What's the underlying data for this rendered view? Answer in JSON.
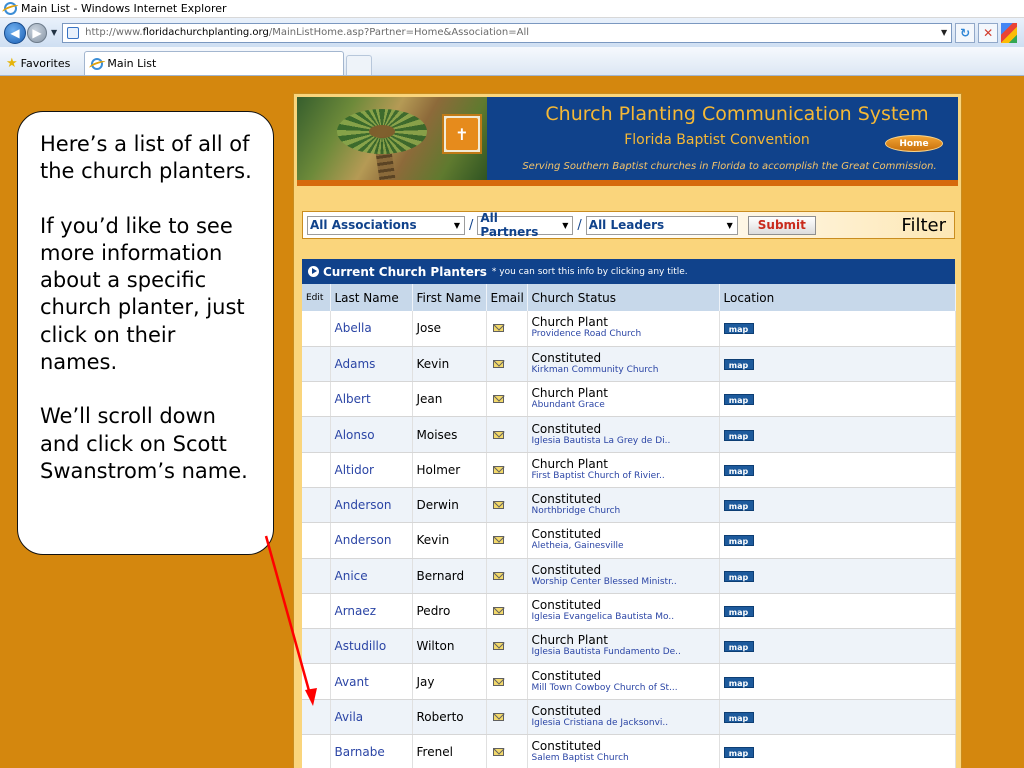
{
  "window": {
    "title": "Main List - Windows Internet Explorer"
  },
  "address": {
    "prefix": "http://www.",
    "host": "floridachurchplanting.org",
    "path": "/MainListHome.asp?Partner=Home&Association=All"
  },
  "favbar": {
    "favorites_label": "Favorites",
    "tab_label": "Main List"
  },
  "banner": {
    "title": "Church Planting Communication System",
    "subtitle": "Florida Baptist Convention",
    "home_label": "Home",
    "tagline": "Serving Southern Baptist churches in Florida to accomplish the Great Commission."
  },
  "filter": {
    "associations": "All Associations",
    "partners": "All Partners",
    "leaders": "All Leaders",
    "slash": "/",
    "submit": "Submit",
    "label": "Filter"
  },
  "table": {
    "title": "Current Church Planters",
    "note": "* you can sort this info by clicking any title.",
    "columns": [
      "Edit",
      "Last Name",
      "First Name",
      "Email",
      "Church Status",
      "Location"
    ],
    "map_label": "map",
    "rows": [
      {
        "last": "Abella",
        "first": "Jose",
        "status": "Church Plant",
        "church": "Providence Road Church"
      },
      {
        "last": "Adams",
        "first": "Kevin",
        "status": "Constituted",
        "church": "Kirkman Community Church"
      },
      {
        "last": "Albert",
        "first": "Jean",
        "status": "Church Plant",
        "church": "Abundant Grace"
      },
      {
        "last": "Alonso",
        "first": "Moises",
        "status": "Constituted",
        "church": "Iglesia Bautista La Grey de Di.."
      },
      {
        "last": "Altidor",
        "first": "Holmer",
        "status": "Church Plant",
        "church": "First Baptist Church of Rivier.."
      },
      {
        "last": "Anderson",
        "first": "Derwin",
        "status": "Constituted",
        "church": "Northbridge Church"
      },
      {
        "last": "Anderson",
        "first": "Kevin",
        "status": "Constituted",
        "church": "Aletheia, Gainesville"
      },
      {
        "last": "Anice",
        "first": "Bernard",
        "status": "Constituted",
        "church": "Worship Center Blessed Ministr.."
      },
      {
        "last": "Arnaez",
        "first": "Pedro",
        "status": "Constituted",
        "church": "Iglesia Evangelica Bautista Mo.."
      },
      {
        "last": "Astudillo",
        "first": "Wilton",
        "status": "Church Plant",
        "church": "Iglesia Bautista Fundamento De.."
      },
      {
        "last": "Avant",
        "first": "Jay",
        "status": "Constituted",
        "church": "Mill Town Cowboy Church of St..."
      },
      {
        "last": "Avila",
        "first": "Roberto",
        "status": "Constituted",
        "church": "Iglesia Cristiana de Jacksonvi.."
      },
      {
        "last": "Barnabe",
        "first": "Frenel",
        "status": "Constituted",
        "church": "Salem Baptist Church"
      }
    ]
  },
  "callout": {
    "p1": "Here’s a list of all of the church planters.",
    "p2": "If you’d like to see more information about a specific church planter, just click on their names.",
    "p3": "We’ll scroll down and click on Scott Swanstrom’s name."
  },
  "colors": {
    "page_bg": "#d4870e",
    "banner_blue": "#10428b",
    "gold": "#f5b836",
    "arrow": "#ff0000"
  }
}
